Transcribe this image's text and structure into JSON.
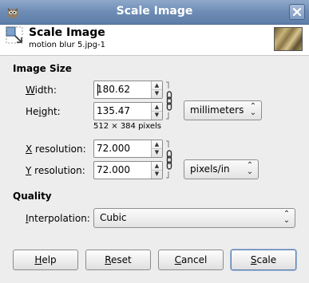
{
  "window": {
    "title": "Scale Image"
  },
  "header": {
    "title": "Scale Image",
    "subtitle": "motion blur 5.jpg-1"
  },
  "image_size": {
    "section_label": "Image Size",
    "width": {
      "label_u": "W",
      "label_rest": "idth:",
      "value": "180.62"
    },
    "height": {
      "label_pre": "He",
      "label_u": "i",
      "label_post": "ght:",
      "value": "135.47"
    },
    "pixels_note": "512 × 384 pixels",
    "size_unit": "millimeters",
    "x_resolution": {
      "label_u": "X",
      "label_rest": " resolution:",
      "value": "72.000"
    },
    "y_resolution": {
      "label_u": "Y",
      "label_rest": " resolution:",
      "value": "72.000"
    },
    "resolution_unit": "pixels/in"
  },
  "quality": {
    "section_label": "Quality",
    "interpolation": {
      "label_u": "I",
      "label_rest": "nterpolation:",
      "value": "Cubic"
    }
  },
  "buttons": {
    "help": {
      "u": "H",
      "rest": "elp"
    },
    "reset": {
      "u": "R",
      "rest": "eset"
    },
    "cancel": {
      "u": "C",
      "rest": "ancel"
    },
    "scale": {
      "u": "S",
      "rest": "cale"
    }
  },
  "colors": {
    "titlebar": "#6d8cb5",
    "dialog_bg": "#ededed",
    "focus_border": "#5b7fb0"
  }
}
